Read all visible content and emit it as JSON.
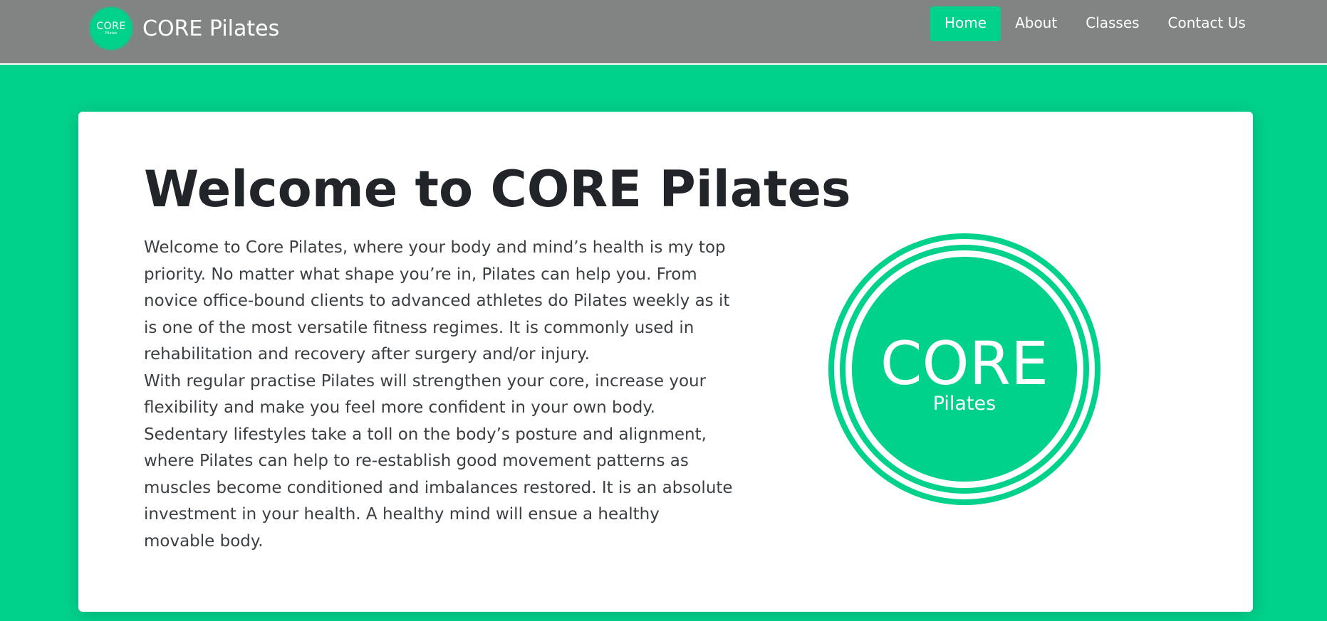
{
  "brand": {
    "logo_line1": "CORE",
    "logo_line2": "Pilates",
    "name": "CORE Pilates"
  },
  "nav": {
    "items": [
      {
        "label": "Home",
        "active": true
      },
      {
        "label": "About",
        "active": false
      },
      {
        "label": "Classes",
        "active": false
      },
      {
        "label": "Contact Us",
        "active": false
      }
    ]
  },
  "hero": {
    "title": "Welcome to CORE Pilates",
    "paragraph1": "Welcome to Core Pilates, where your body and mind’s health is my top priority. No matter what shape you’re in, Pilates can help you. From novice office-bound clients to advanced athletes do Pilates weekly as it is one of the most versatile fitness regimes. It is commonly used in rehabilitation and recovery after surgery and/or injury.",
    "paragraph2": "With regular practise Pilates will strengthen your core, increase your flexibility and make you feel more confident in your own body. Sedentary lifestyles take a toll on the body’s posture and alignment, where Pilates can help to re-establish good movement patterns as muscles become conditioned and imbalances restored. It is an absolute investment in your health. A healthy mind will ensue a healthy movable body.",
    "logo": {
      "line1": "CORE",
      "line2": "Pilates"
    }
  },
  "colors": {
    "accent": "#00d18b",
    "navbar": "#808583",
    "card": "#ffffff",
    "heading": "#212529"
  }
}
